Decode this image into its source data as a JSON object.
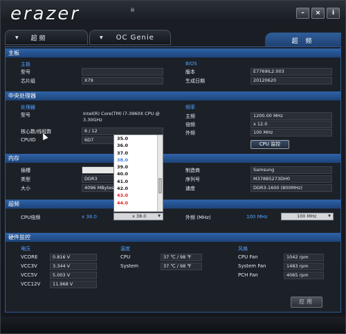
{
  "title": {
    "logo": "erazer",
    "reg": "®"
  },
  "window_buttons": [
    "–",
    "×",
    "i"
  ],
  "tabs": {
    "tab1": "超  频",
    "tab2": "OC Genie",
    "active": "超  频"
  },
  "sections": {
    "mainboard": {
      "header": "主板",
      "sub_mb": "主板",
      "model_label": "型号",
      "chipset_label": "芯片组",
      "chipset_value": "X79",
      "bios_sub": "BIOS",
      "version_label": "版本",
      "version_value": "E7769IL2.003",
      "date_label": "生成日期",
      "date_value": "20120620"
    },
    "cpu": {
      "header": "中央处理器",
      "sub_proc": "处理器",
      "model_label": "型号",
      "model_value": "Intel(R) Core(TM) i7-3960X CPU @ 3.30GHz",
      "cores_label": "核心数/线程数",
      "cores_value": "6 / 12",
      "cpuid_label": "CPUID",
      "cpuid_value": "6D7",
      "freq_sub": "频率",
      "main_freq_label": "主频",
      "main_freq_value": "1200.00 MHz",
      "mult_label": "倍频",
      "mult_value": "x 12.0",
      "ext_label": "外频",
      "ext_value": "100 MHz",
      "cpu_monitor_button": "CPU 监控"
    },
    "memory": {
      "header": "内存",
      "slot_label": "插槽",
      "type_label": "类型",
      "type_value": "DDR3",
      "size_label": "大小",
      "size_value": "4096 MBytes",
      "mfr_label": "制造商",
      "mfr_value": "Samsung",
      "serial_label": "序列号",
      "serial_value": "M378B5273DH0",
      "speed_label": "速度",
      "speed_value": "DDR3-1600 (800MHz)"
    },
    "oc": {
      "header": "超频",
      "cpu_mult_label": "CPU倍频",
      "cpu_mult_current": "x 38.0",
      "cpu_mult_select": "x 38.0",
      "ext_label": "外频 (MHz)",
      "ext_current": "100 MHz",
      "ext_select": "100 MHz"
    },
    "hw": {
      "header": "硬件监控",
      "voltage_sub": "电压",
      "vcore_label": "VCORE",
      "vcore_value": "0.816 V",
      "vcc3_label": "VCC3V",
      "vcc3_value": "3.344 V",
      "vcc5_label": "VCC5V",
      "vcc5_value": "5.003 V",
      "vcc12_label": "VCC12V",
      "vcc12_value": "11.968 V",
      "temp_sub": "温度",
      "cpu_t_label": "CPU",
      "cpu_t_value": "37 ℃ / 98 ℉",
      "sys_t_label": "System",
      "sys_t_value": "37 ℃ / 98 ℉",
      "fan_sub": "风扇",
      "cpu_fan_label": "CPU Fan",
      "cpu_fan_value": "1042 rpm",
      "sys_fan_label": "System Fan",
      "sys_fan_value": "1483 rpm",
      "pch_fan_label": "PCH Fan",
      "pch_fan_value": "4065 rpm"
    }
  },
  "dropdown_items": [
    {
      "label": "35.0",
      "color": "#111111"
    },
    {
      "label": "36.0",
      "color": "#111111"
    },
    {
      "label": "37.0",
      "color": "#111111"
    },
    {
      "label": "38.0",
      "color": "#3b7de0"
    },
    {
      "label": "39.0",
      "color": "#111111"
    },
    {
      "label": "40.0",
      "color": "#111111"
    },
    {
      "label": "41.0",
      "color": "#111111"
    },
    {
      "label": "42.0",
      "color": "#111111"
    },
    {
      "label": "43.0",
      "color": "#e02020"
    },
    {
      "label": "44.0",
      "color": "#e02020"
    }
  ],
  "apply_button": "应用"
}
